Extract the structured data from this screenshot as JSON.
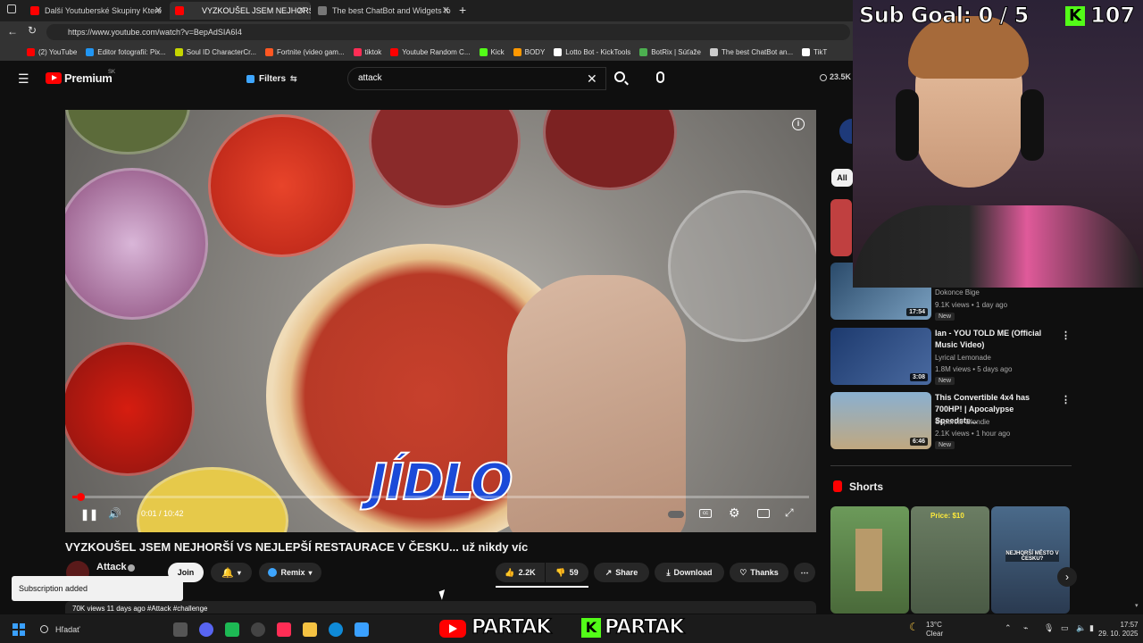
{
  "browser": {
    "tabs": [
      {
        "label": "Další Youtuberské Skupiny Které",
        "color": "#ff0000"
      },
      {
        "label": "VYZKOUŠEL JSEM NEJHORŠÍ",
        "color": "#ff0000",
        "active": true
      },
      {
        "label": "The best ChatBot and Widgets fo",
        "color": "#888888"
      }
    ],
    "url": "https://www.youtube.com/watch?v=BepAdSIA6I4",
    "bookmarks": [
      {
        "label": "(2) YouTube",
        "color": "#ff0000"
      },
      {
        "label": "Editor fotografií: Pix...",
        "color": "#2196f3"
      },
      {
        "label": "Soul ID CharacterCr...",
        "color": "#c6d600"
      },
      {
        "label": "Fortnite (video gam...",
        "color": "#ff5722"
      },
      {
        "label": "tiktok",
        "color": "#ff2d55"
      },
      {
        "label": "Youtube Random C...",
        "color": "#ff0000"
      },
      {
        "label": "Kick",
        "color": "#53fc18"
      },
      {
        "label": "BODY",
        "color": "#ff9800"
      },
      {
        "label": "Lotto Bot - KickTools",
        "color": "#ffffff"
      },
      {
        "label": "BotRix | Súťaže",
        "color": "#4caf50"
      },
      {
        "label": "The best ChatBot an...",
        "color": "#cccccc"
      },
      {
        "label": "TikT",
        "color": "#ffffff"
      }
    ]
  },
  "youtube": {
    "logo_text": "Premium",
    "logo_region": "SK",
    "filters_label": "Filters",
    "search_value": "attack",
    "views_top": "23.5K",
    "video": {
      "caption": "JÍDLO",
      "time": "0:01 / 10:42",
      "progress": 0.0016,
      "title": "VYZKOUŠEL JSEM NEJHORŠÍ VS NEJLEPŠÍ RESTAURACE V ČESKU... už nikdy víc",
      "channel": "Attack",
      "join_label": "Join",
      "remix_label": "Remix",
      "likes": "2.2K",
      "dislikes": "59",
      "share_label": "Share",
      "download_label": "Download",
      "thanks_label": "Thanks",
      "desc_peek": "70K views  11 days ago  #Attack #challenge"
    },
    "toast": "Subscription added",
    "right": {
      "chip_all": "All",
      "recs": [
        {
          "title": "",
          "channel": "Dokonce Bige",
          "meta": "9.1K views • 1 day ago",
          "badge": "New",
          "duration": "17:54",
          "thumb": "#2a4a6a"
        },
        {
          "title": "Ian - YOU TOLD ME (Official Music Video)",
          "channel": "Lyrical Lemonade",
          "meta": "1.8M views • 5 days ago",
          "badge": "New",
          "duration": "3:08",
          "thumb": "#1d3a6e"
        },
        {
          "title": "This Convertible 4x4 has 700HP! | Apocalypse Speedste...",
          "channel": "Supercar Blondie",
          "meta": "2.1K views • 1 hour ago",
          "badge": "New",
          "duration": "6:46",
          "thumb": "#6c8fb0"
        }
      ],
      "shorts_title": "Shorts",
      "shorts": [
        {
          "color": "#5e8a4a",
          "text": ""
        },
        {
          "color": "#6b7d63",
          "text": "Price: $10"
        },
        {
          "color": "#3f5e7a",
          "text": "NEJHORŠÍ MĚSTO V ČESKU?"
        }
      ]
    }
  },
  "stream": {
    "goal": "Sub Goal:  0 / 5",
    "kick_count": "107",
    "banner_left": "PARTAK",
    "banner_right": "PARTAK"
  },
  "taskbar": {
    "search_placeholder": "Hľadať",
    "weather_temp": "13°C",
    "weather_desc": "Clear",
    "time": "17:57",
    "date": "29. 10. 2025"
  }
}
